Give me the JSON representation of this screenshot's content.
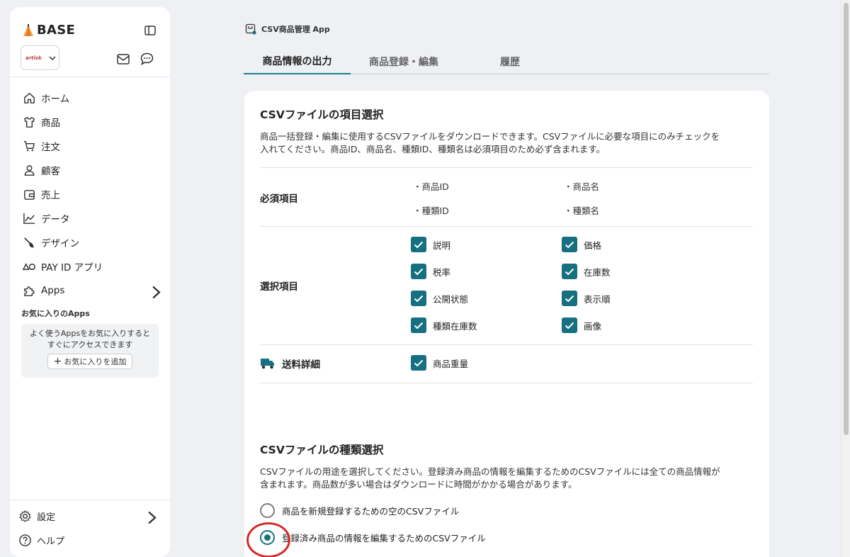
{
  "sidebar": {
    "brand": "BASE",
    "shop_logo_text": "artisk",
    "nav": [
      {
        "label": "ホーム",
        "icon": "home-icon"
      },
      {
        "label": "商品",
        "icon": "shirt-icon"
      },
      {
        "label": "注文",
        "icon": "cart-icon"
      },
      {
        "label": "顧客",
        "icon": "person-icon"
      },
      {
        "label": "売上",
        "icon": "wallet-icon"
      },
      {
        "label": "データ",
        "icon": "chart-line-icon"
      },
      {
        "label": "デザイン",
        "icon": "brush-icon"
      },
      {
        "label": "PAY ID アプリ",
        "icon": "payid-icon"
      },
      {
        "label": "Apps",
        "icon": "puzzle-icon"
      }
    ],
    "favorites": {
      "title": "お気に入りのApps",
      "empty_text_line1": "よく使うAppsをお気に入りすると",
      "empty_text_line2": "すぐにアクセスできます",
      "add_button": "お気に入りを追加"
    },
    "bottom": [
      {
        "label": "設定",
        "icon": "gear-icon"
      },
      {
        "label": "ヘルプ",
        "icon": "help-icon"
      }
    ]
  },
  "app": {
    "title": "CSV商品管理 App"
  },
  "tabs": [
    {
      "label": "商品情報の出力",
      "active": true
    },
    {
      "label": "商品登録・編集",
      "active": false
    },
    {
      "label": "履歴",
      "active": false
    }
  ],
  "item_section": {
    "title": "CSVファイルの項目選択",
    "description_line1": "商品一括登録・編集に使用するCSVファイルをダウンロードできます。CSVファイルに必要な項目にのみチェックを",
    "description_line2": "入れてください。商品ID、商品名、種類ID、種類名は必須項目のため必ず含まれます。",
    "required": {
      "label": "必須項目",
      "items": [
        "・商品ID",
        "・商品名",
        "・種類ID",
        "・種類名"
      ]
    },
    "optional": {
      "label": "選択項目",
      "items": [
        {
          "label": "説明",
          "checked": true
        },
        {
          "label": "価格",
          "checked": true
        },
        {
          "label": "税率",
          "checked": true
        },
        {
          "label": "在庫数",
          "checked": true
        },
        {
          "label": "公開状態",
          "checked": true
        },
        {
          "label": "表示順",
          "checked": true
        },
        {
          "label": "種類在庫数",
          "checked": true
        },
        {
          "label": "画像",
          "checked": true
        }
      ]
    },
    "shipping": {
      "label": "送料詳細",
      "items": [
        {
          "label": "商品重量",
          "checked": true
        }
      ]
    }
  },
  "type_section": {
    "title": "CSVファイルの種類選択",
    "description_line1": "CSVファイルの用途を選択してください。登録済み商品の情報を編集するためのCSVファイルには全ての商品情報が",
    "description_line2": "含まれます。商品数が多い場合はダウンロードに時間がかかる場合があります。",
    "options": [
      {
        "label": "商品を新規登録するための空のCSVファイル",
        "selected": false
      },
      {
        "label": "登録済み商品の情報を編集するためのCSVファイル",
        "selected": true
      }
    ]
  },
  "colors": {
    "accent": "#16707f",
    "highlight": "#d42a2a",
    "background": "#eef0f3"
  }
}
